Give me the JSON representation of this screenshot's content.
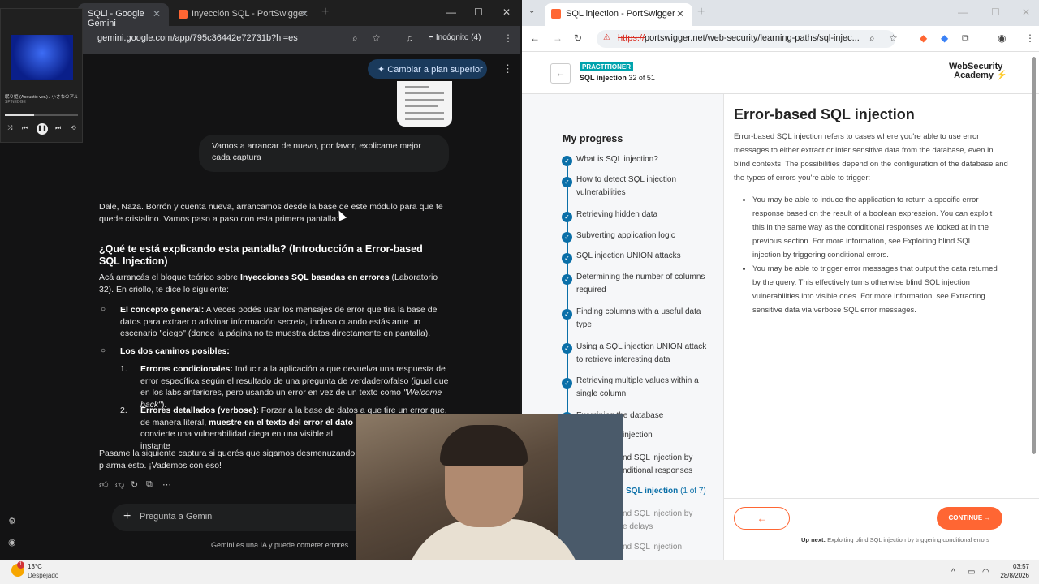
{
  "left_browser": {
    "tabs": [
      {
        "label": "SQLi - Google Gemini"
      },
      {
        "label": "Inyección SQL - PortSwigger"
      }
    ],
    "url": "gemini.google.com/app/795c36442e72731b?hl=es",
    "incognito": "Incógnito (4)",
    "upgrade_button": "Cambiar a plan superior",
    "user_message": "Vamos a arrancar de nuevo, por favor, explicame mejor cada captura",
    "response": {
      "intro": "Dale, Naza. Borrón y cuenta nueva, arrancamos desde la base de este módulo para que te quede cristalino. Vamos paso a paso con esta primera pantalla:",
      "heading": "¿Qué te está explicando esta pantalla? (Introducción a Error-based SQL Injection)",
      "p1_pre": "Acá arrancás el bloque teórico sobre ",
      "p1_bold": "Inyecciones SQL basadas en errores",
      "p1_post": " (Laboratorio 32). En criollo, te dice lo siguiente:",
      "b1_bold": "El concepto general:",
      "b1_text": " A veces podés usar los mensajes de error que tira la base de datos para extraer o adivinar información secreta, incluso cuando estás ante un escenario \"ciego\" (donde la página no te muestra datos directamente en pantalla).",
      "b2_bold": "Los dos caminos posibles:",
      "n1_num": "1.",
      "n1_bold": "Errores condicionales:",
      "n1_text": " Inducir a la aplicación a que devuelva una respuesta de error específica según el resultado de una pregunta de verdadero/falso (igual que en los labs anteriores, pero usando un error en vez de un texto como ",
      "n1_italic": "\"Welcome back\"",
      "n1_end": ").",
      "n2_num": "2.",
      "n2_bold": "Errores detallados (verbose):",
      "n2_text": " Forzar a la base de datos a que tire un error que, de manera literal, ",
      "n2_bold2": "muestre en el texto del error el dato que de",
      "n2_line3": "convierte una vulnerabilidad ciega en una visible al instante",
      "closing": "Pasame la siguiente captura si querés que sigamos desmenuzando el p arma esto. ¡Vademos con eso!"
    },
    "ask_placeholder": "Pregunta a Gemini",
    "disclaimer": "Gemini es una IA y puede cometer errores."
  },
  "media_player": {
    "title": "眠り姫 (Acoustic ver.) / 小さなのアル",
    "subtitle": "SPINEDGE"
  },
  "right_browser": {
    "tab_label": "SQL injection - PortSwigger",
    "url_https": "https://",
    "url_rest": "portswigger.net/web-security/learning-paths/sql-injec...",
    "badge": "PRACTITIONER",
    "path_name": "SQL injection",
    "path_progress": "32 of 51",
    "logo_line1": "WebSecurity",
    "logo_line2": "Academy",
    "my_progress": "My progress",
    "progress_items": [
      {
        "label": "What is SQL injection?"
      },
      {
        "label": "How to detect SQL injection vulnerabilities"
      },
      {
        "label": "Retrieving hidden data"
      },
      {
        "label": "Subverting application logic"
      },
      {
        "label": "SQL injection UNION attacks"
      },
      {
        "label": "Determining the number of columns required"
      },
      {
        "label": "Finding columns with a useful data type"
      },
      {
        "label": "Using a SQL injection UNION attack to retrieve interesting data"
      },
      {
        "label": "Retrieving multiple values within a single column"
      },
      {
        "label": "Examining the database"
      },
      {
        "label": "Blind SQL injection"
      },
      {
        "label": "Blind SQL injection by triggering conditional responses"
      },
      {
        "label": "Error-based SQL injection",
        "sub": "(1 of 7)"
      },
      {
        "label": "Blind SQL injection by triggering time delays"
      },
      {
        "label": "Blind SQL injection"
      }
    ],
    "visible_progress": {
      "i9": "Examining the database",
      "i10": "injection",
      "i11a": "nd SQL injection by",
      "i11b": "nditional responses",
      "i12": "SQL injection",
      "i12sub": "(1 of 7)",
      "i13a": "nd SQL injection by",
      "i13b": "e delays",
      "i14": "nd SQL injection"
    },
    "heading": "Error-based SQL injection",
    "intro": "Error-based SQL injection refers to cases where you're able to use error messages to either extract or infer sensitive data from the database, even in blind contexts. The possibilities depend on the configuration of the database and the types of errors you're able to trigger:",
    "bullets": [
      "You may be able to induce the application to return a specific error response based on the result of a boolean expression. You can exploit this in the same way as the conditional responses we looked at in the previous section. For more information, see Exploiting blind SQL injection by triggering conditional errors.",
      "You may be able to trigger error messages that output the data returned by the query. This effectively turns otherwise blind SQL injection vulnerabilities into visible ones. For more information, see Extracting sensitive data via verbose SQL error messages."
    ],
    "continue_button": "CONTINUE",
    "upnext_label": "Up next:",
    "upnext_text": " Exploiting blind SQL injection by triggering conditional errors"
  },
  "taskbar": {
    "temperature": "13°C",
    "condition": "Despejado",
    "notifications": "1",
    "time": "03:57",
    "date": "28/8/2026"
  }
}
